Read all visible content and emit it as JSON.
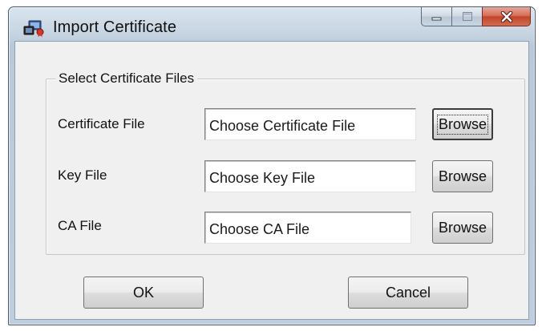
{
  "window": {
    "title": "Import Certificate",
    "icon": "certificate-app-icon",
    "controls": {
      "minimize_icon": "minimize-icon",
      "maximize_icon": "maximize-icon",
      "close_icon": "close-icon",
      "close_color": "#c7442a"
    }
  },
  "group": {
    "legend": "Select Certificate Files"
  },
  "fields": [
    {
      "label": "Certificate File",
      "value": "Choose Certificate File",
      "button": "Browse",
      "focused": true
    },
    {
      "label": "Key File",
      "value": "Choose Key File",
      "button": "Browse",
      "focused": false
    },
    {
      "label": "CA File",
      "value": "Choose CA File",
      "button": "Browse",
      "focused": false
    }
  ],
  "buttons": {
    "ok": "OK",
    "cancel": "Cancel"
  }
}
